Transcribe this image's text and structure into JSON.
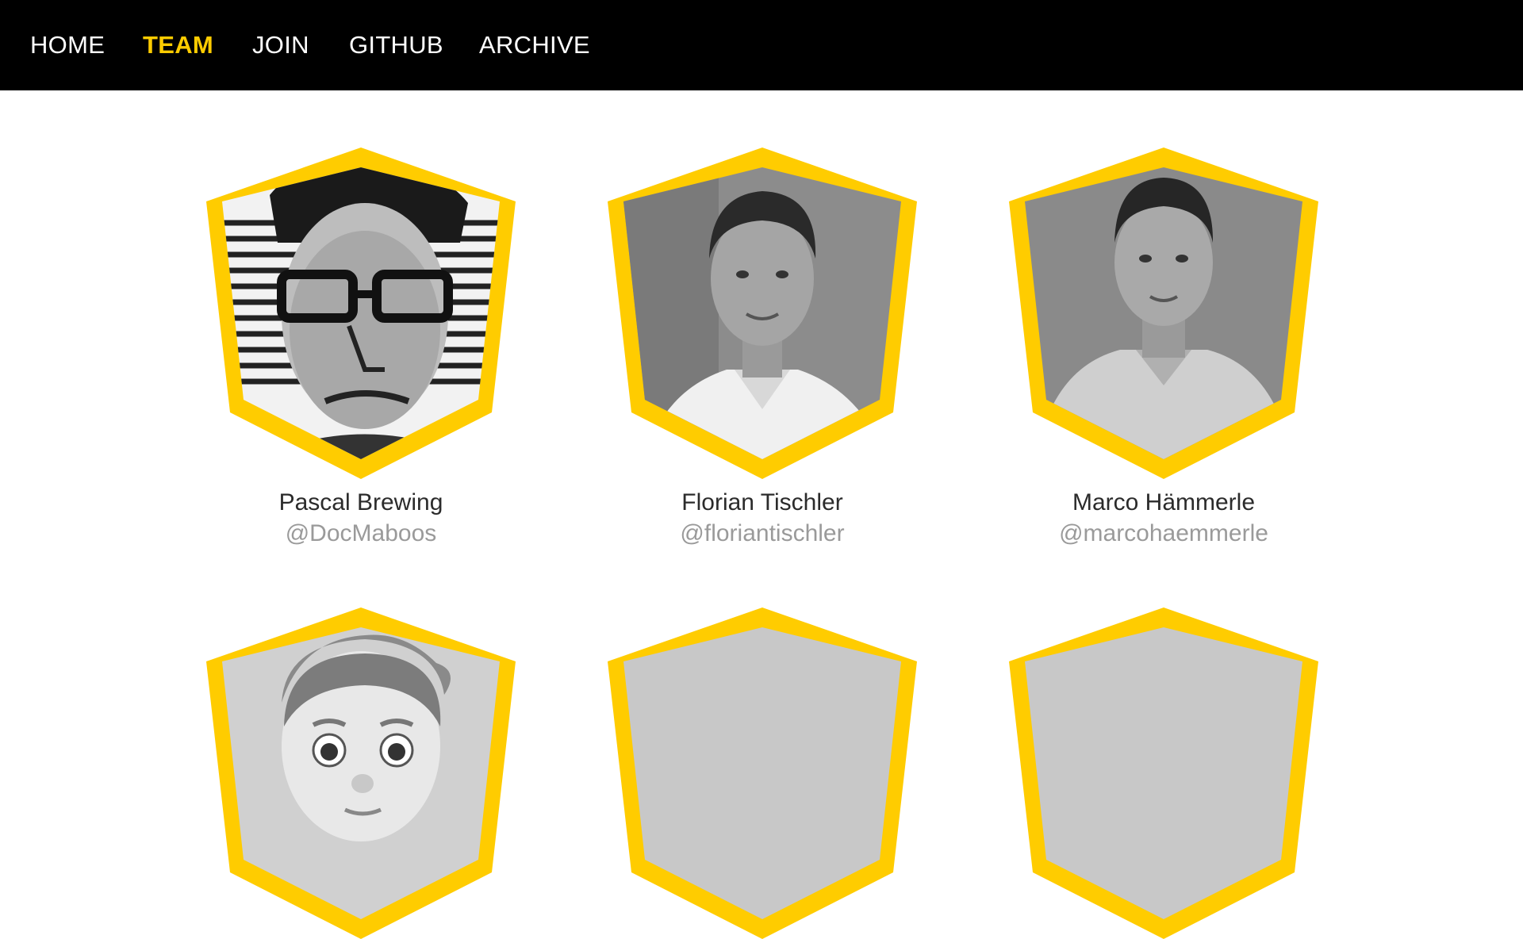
{
  "nav": {
    "items": [
      {
        "label": "HOME",
        "active": false
      },
      {
        "label": "TEAM",
        "active": true
      },
      {
        "label": "JOIN",
        "active": false
      },
      {
        "label": "GITHUB",
        "active": false
      },
      {
        "label": "ARCHIVE",
        "active": false
      }
    ]
  },
  "colors": {
    "nav_bg": "#000000",
    "accent": "#ffcc00",
    "name_text": "#2b2b2b",
    "handle_text": "#9a9a9a",
    "placeholder_fill": "#c8c8c8"
  },
  "team": {
    "members": [
      {
        "name": "Pascal Brewing",
        "handle": "@DocMaboos",
        "photo": "portrait-photo"
      },
      {
        "name": "Florian Tischler",
        "handle": "@floriantischler",
        "photo": "portrait-photo"
      },
      {
        "name": "Marco Hämmerle",
        "handle": "@marcohaemmerle",
        "photo": "portrait-photo"
      },
      {
        "name": "",
        "handle": "",
        "photo": "memoji-avatar"
      },
      {
        "name": "",
        "handle": "",
        "photo": "placeholder"
      },
      {
        "name": "",
        "handle": "",
        "photo": "placeholder"
      }
    ]
  }
}
